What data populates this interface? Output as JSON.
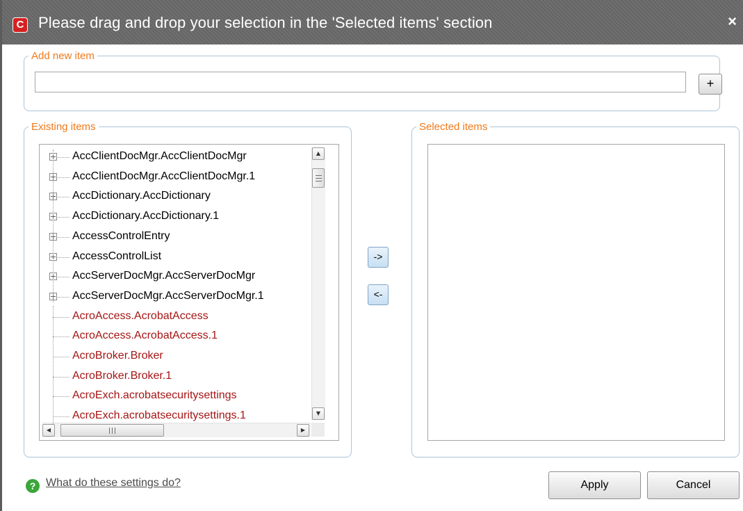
{
  "window": {
    "title": "Please drag and drop your selection in the 'Selected items' section",
    "app_icon_glyph": "C",
    "close_glyph": "×",
    "titlebar_color": "#6a6a6a"
  },
  "add_group": {
    "legend": "Add new item",
    "input_value": "",
    "add_button_label": "+"
  },
  "existing_group": {
    "legend": "Existing items",
    "items": [
      {
        "label": "AccClientDocMgr.AccClientDocMgr",
        "expandable": true
      },
      {
        "label": "AccClientDocMgr.AccClientDocMgr.1",
        "expandable": true
      },
      {
        "label": "AccDictionary.AccDictionary",
        "expandable": true
      },
      {
        "label": "AccDictionary.AccDictionary.1",
        "expandable": true
      },
      {
        "label": "AccessControlEntry",
        "expandable": true
      },
      {
        "label": "AccessControlList",
        "expandable": true
      },
      {
        "label": "AccServerDocMgr.AccServerDocMgr",
        "expandable": true
      },
      {
        "label": "AccServerDocMgr.AccServerDocMgr.1",
        "expandable": true
      },
      {
        "label": "AcroAccess.AcrobatAccess",
        "expandable": false
      },
      {
        "label": "AcroAccess.AcrobatAccess.1",
        "expandable": false
      },
      {
        "label": "AcroBroker.Broker",
        "expandable": false
      },
      {
        "label": "AcroBroker.Broker.1",
        "expandable": false
      },
      {
        "label": "AcroExch.acrobatsecuritysettings",
        "expandable": false
      },
      {
        "label": "AcroExch.acrobatsecuritysettings.1",
        "expandable": false
      }
    ],
    "expand_glyph": "+",
    "scroll_up_glyph": "▲",
    "scroll_down_glyph": "▼",
    "scroll_left_glyph": "◀",
    "scroll_right_glyph": "▶"
  },
  "transfer": {
    "move_right_label": "->",
    "move_left_label": "<-"
  },
  "selected_group": {
    "legend": "Selected items",
    "items": []
  },
  "footer": {
    "help_icon_glyph": "?",
    "help_link": "What do these settings do?",
    "apply_label": "Apply",
    "cancel_label": "Cancel"
  },
  "colors": {
    "legend": "#f07a1a",
    "leaf_item": "#a51515",
    "help_icon": "#3aa63a"
  }
}
